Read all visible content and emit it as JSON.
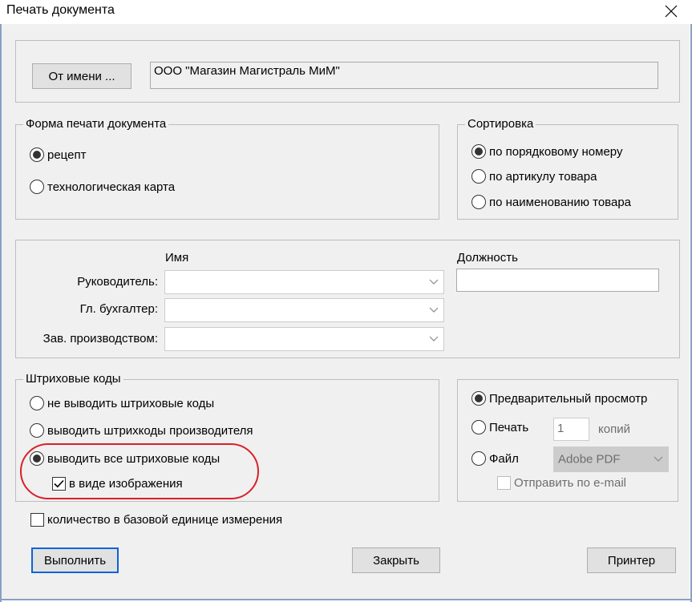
{
  "window": {
    "title": "Печать документа",
    "close_icon": "close-icon"
  },
  "sender": {
    "button_label": "От имени ...",
    "value": "ООО \"Магазин Магистраль МиМ\""
  },
  "print_form": {
    "legend": "Форма печати документа",
    "options": [
      {
        "label": "рецепт",
        "selected": true
      },
      {
        "label": "технологическая карта",
        "selected": false
      }
    ]
  },
  "sorting": {
    "legend": "Сортировка",
    "options": [
      {
        "label": "по порядковому номеру",
        "selected": true
      },
      {
        "label": "по артикулу товара",
        "selected": false
      },
      {
        "label": "по наименованию товара",
        "selected": false
      }
    ]
  },
  "signatures": {
    "name_header": "Имя",
    "position_header": "Должность",
    "rows": [
      {
        "label": "Руководитель:",
        "value": "",
        "position": ""
      },
      {
        "label": "Гл. бухгалтер:",
        "value": ""
      },
      {
        "label": "Зав. производством:",
        "value": ""
      }
    ]
  },
  "barcodes": {
    "legend": "Штриховые коды",
    "options": [
      {
        "label": "не выводить штриховые коды",
        "selected": false
      },
      {
        "label": "выводить штрихкоды производителя",
        "selected": false
      },
      {
        "label": "выводить все штриховые коды",
        "selected": true
      }
    ],
    "as_image": {
      "label": "в виде изображения",
      "checked": true
    }
  },
  "output": {
    "options": [
      {
        "label": "Предварительный просмотр",
        "selected": true
      },
      {
        "label": "Печать",
        "selected": false
      },
      {
        "label": "Файл",
        "selected": false
      }
    ],
    "copies_value": "1",
    "copies_label": "копий",
    "file_format": "Adobe PDF",
    "email": {
      "label": "Отправить по e-mail",
      "checked": false
    }
  },
  "base_unit": {
    "label": "количество в базовой единице измерения",
    "checked": false
  },
  "buttons": {
    "execute": "Выполнить",
    "close": "Закрыть",
    "printer": "Принтер"
  },
  "colors": {
    "highlight": "#d9202a",
    "default_button_border": "#0a64d6",
    "dialog_background": "#f0f0f0"
  }
}
